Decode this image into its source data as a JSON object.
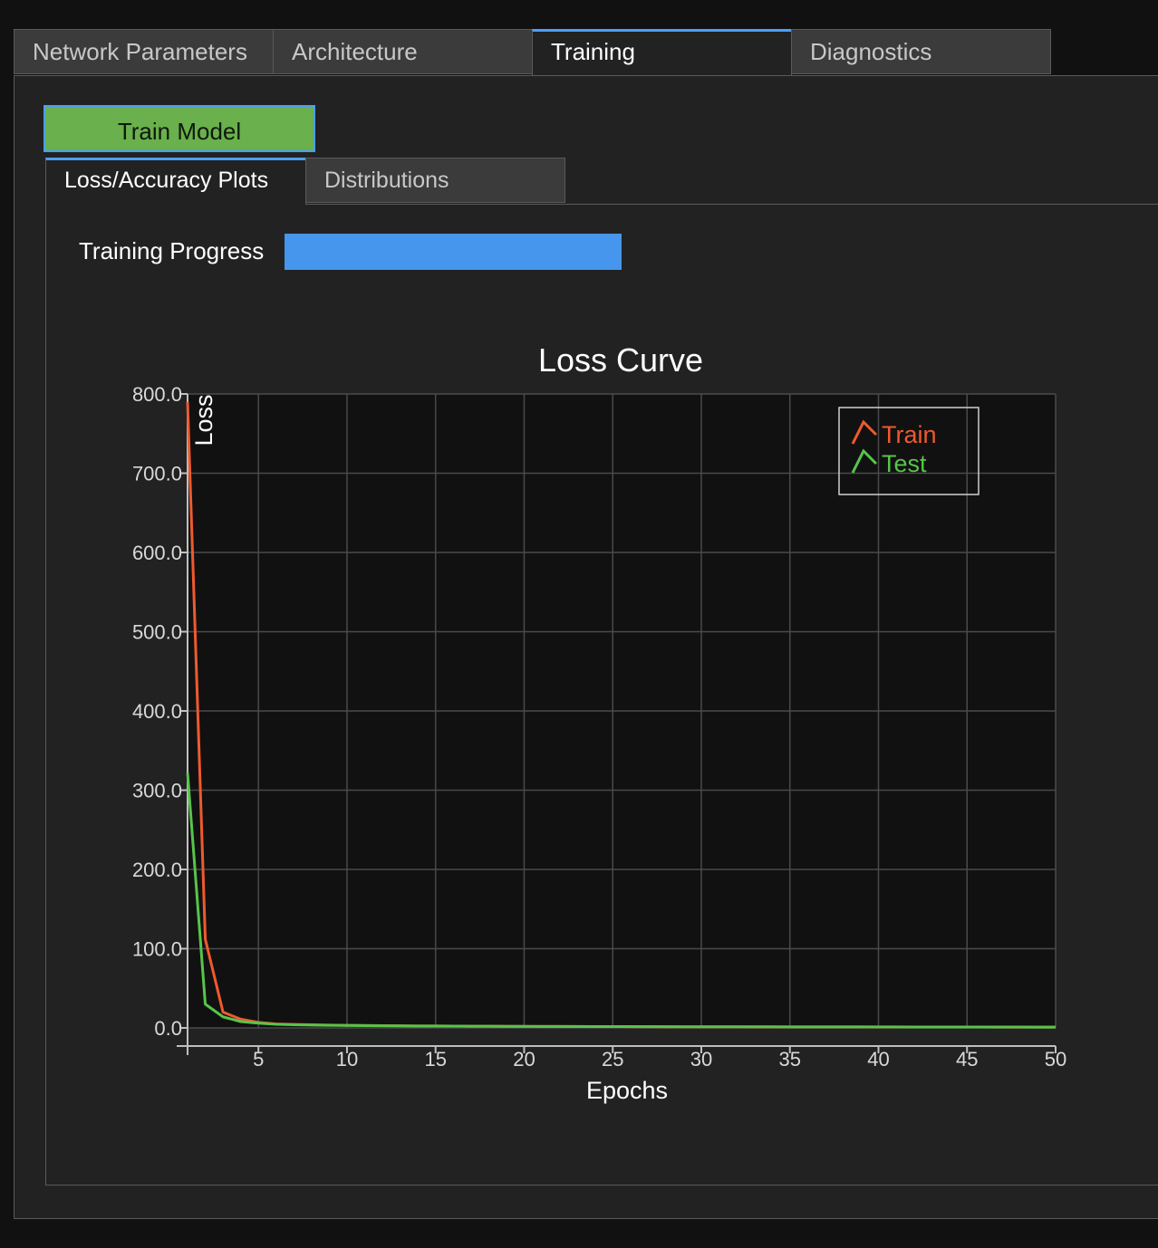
{
  "tabs": [
    {
      "label": "Network Parameters",
      "active": false
    },
    {
      "label": "Architecture",
      "active": false
    },
    {
      "label": "Training",
      "active": true
    },
    {
      "label": "Diagnostics",
      "active": false
    }
  ],
  "train_button": {
    "label": "Train Model"
  },
  "inner_tabs": [
    {
      "label": "Loss/Accuracy Plots",
      "active": true
    },
    {
      "label": "Distributions",
      "active": false
    }
  ],
  "progress": {
    "label": "Training Progress",
    "fraction": 1.0
  },
  "colors": {
    "accent": "#4a9eff",
    "button": "#6ab04c",
    "train": "#ef5a2e",
    "test": "#57c44a"
  },
  "chart_data": {
    "type": "line",
    "title": "Loss Curve",
    "xlabel": "Epochs",
    "ylabel": "Loss",
    "xlim": [
      1,
      50
    ],
    "ylim": [
      0,
      800
    ],
    "x_ticks": [
      5,
      10,
      15,
      20,
      25,
      30,
      35,
      40,
      45,
      50
    ],
    "y_ticks": [
      "0.0",
      "100.0",
      "200.0",
      "300.0",
      "400.0",
      "500.0",
      "600.0",
      "700.0",
      "800.0"
    ],
    "grid": true,
    "legend_position": "top-right",
    "x": [
      1,
      2,
      3,
      4,
      5,
      6,
      7,
      8,
      9,
      10,
      11,
      12,
      13,
      14,
      15,
      16,
      17,
      18,
      19,
      20,
      21,
      22,
      23,
      24,
      25,
      26,
      27,
      28,
      29,
      30,
      31,
      32,
      33,
      34,
      35,
      36,
      37,
      38,
      39,
      40,
      41,
      42,
      43,
      44,
      45,
      46,
      47,
      48,
      49,
      50
    ],
    "series": [
      {
        "name": "Train",
        "color": "#ef5a2e",
        "values": [
          790,
          112,
          20,
          11,
          7,
          5,
          4.5,
          4,
          3.6,
          3.3,
          3.1,
          2.9,
          2.7,
          2.5,
          2.4,
          2.3,
          2.2,
          2.1,
          2.0,
          1.9,
          1.85,
          1.8,
          1.75,
          1.7,
          1.65,
          1.6,
          1.55,
          1.5,
          1.45,
          1.4,
          1.38,
          1.36,
          1.34,
          1.32,
          1.3,
          1.28,
          1.26,
          1.24,
          1.22,
          1.2,
          1.18,
          1.16,
          1.14,
          1.12,
          1.1,
          1.08,
          1.06,
          1.04,
          1.02,
          1.0
        ]
      },
      {
        "name": "Test",
        "color": "#57c44a",
        "values": [
          322,
          30,
          14,
          8,
          6,
          4.5,
          4,
          3.6,
          3.3,
          3.1,
          2.9,
          2.7,
          2.6,
          2.5,
          2.4,
          2.3,
          2.2,
          2.1,
          2.0,
          1.95,
          1.9,
          1.85,
          1.8,
          1.75,
          1.7,
          1.65,
          1.6,
          1.55,
          1.5,
          1.45,
          1.42,
          1.4,
          1.38,
          1.36,
          1.34,
          1.32,
          1.3,
          1.28,
          1.26,
          1.24,
          1.22,
          1.2,
          1.18,
          1.16,
          1.14,
          1.12,
          1.1,
          1.08,
          1.06,
          1.04
        ]
      }
    ]
  }
}
